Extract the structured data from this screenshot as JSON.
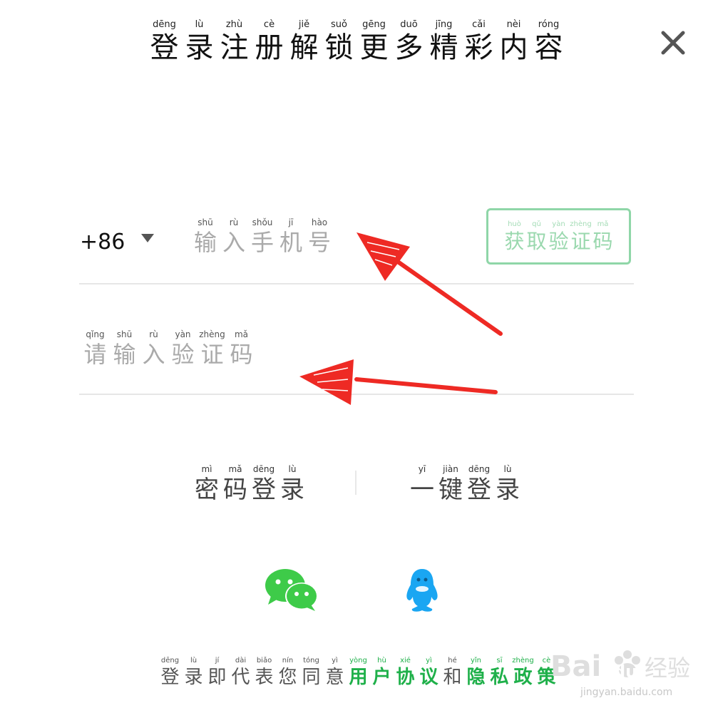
{
  "header": {
    "title": [
      {
        "hz": "登",
        "py": "dēng"
      },
      {
        "hz": "录",
        "py": "lù"
      },
      {
        "hz": "注",
        "py": "zhù"
      },
      {
        "hz": "册",
        "py": "cè"
      },
      {
        "hz": "解",
        "py": "jiě"
      },
      {
        "hz": "锁",
        "py": "suǒ"
      },
      {
        "hz": "更",
        "py": "gēng"
      },
      {
        "hz": "多",
        "py": "duō"
      },
      {
        "hz": "精",
        "py": "jīng"
      },
      {
        "hz": "彩",
        "py": "cǎi"
      },
      {
        "hz": "内",
        "py": "nèi"
      },
      {
        "hz": "容",
        "py": "róng"
      }
    ],
    "close_icon": "close-icon"
  },
  "phone": {
    "country_code": "+86",
    "placeholder": [
      {
        "hz": "输",
        "py": "shū"
      },
      {
        "hz": "入",
        "py": "rù"
      },
      {
        "hz": "手",
        "py": "shǒu"
      },
      {
        "hz": "机",
        "py": "jī"
      },
      {
        "hz": "号",
        "py": "hào"
      }
    ],
    "get_code_button": [
      {
        "hz": "获",
        "py": "huò"
      },
      {
        "hz": "取",
        "py": "qǔ"
      },
      {
        "hz": "验",
        "py": "yàn"
      },
      {
        "hz": "证",
        "py": "zhèng"
      },
      {
        "hz": "码",
        "py": "mǎ"
      }
    ]
  },
  "code": {
    "placeholder": [
      {
        "hz": "请",
        "py": "qǐng"
      },
      {
        "hz": "输",
        "py": "shū"
      },
      {
        "hz": "入",
        "py": "rù"
      },
      {
        "hz": "验",
        "py": "yàn"
      },
      {
        "hz": "证",
        "py": "zhèng"
      },
      {
        "hz": "码",
        "py": "mǎ"
      }
    ]
  },
  "login_options": {
    "password": [
      {
        "hz": "密",
        "py": "mì"
      },
      {
        "hz": "码",
        "py": "mǎ"
      },
      {
        "hz": "登",
        "py": "dēng"
      },
      {
        "hz": "录",
        "py": "lù"
      }
    ],
    "one_click": [
      {
        "hz": "一",
        "py": "yī"
      },
      {
        "hz": "键",
        "py": "jiàn"
      },
      {
        "hz": "登",
        "py": "dēng"
      },
      {
        "hz": "录",
        "py": "lù"
      }
    ]
  },
  "social": {
    "wechat_icon": "wechat-icon",
    "qq_icon": "qq-icon"
  },
  "agreement": {
    "prefix": [
      {
        "hz": "登",
        "py": "dēng"
      },
      {
        "hz": "录",
        "py": "lù"
      },
      {
        "hz": "即",
        "py": "jí"
      },
      {
        "hz": "代",
        "py": "dài"
      },
      {
        "hz": "表",
        "py": "biǎo"
      },
      {
        "hz": "您",
        "py": "nín"
      },
      {
        "hz": "同",
        "py": "tóng"
      },
      {
        "hz": "意",
        "py": "yì"
      }
    ],
    "user_agreement": [
      {
        "hz": "用",
        "py": "yòng"
      },
      {
        "hz": "户",
        "py": "hù"
      },
      {
        "hz": "协",
        "py": "xié"
      },
      {
        "hz": "议",
        "py": "yì"
      }
    ],
    "and": [
      {
        "hz": "和",
        "py": "hé"
      }
    ],
    "privacy_policy": [
      {
        "hz": "隐",
        "py": "yǐn"
      },
      {
        "hz": "私",
        "py": "sī"
      },
      {
        "hz": "政",
        "py": "zhèng"
      },
      {
        "hz": "策",
        "py": "cè"
      }
    ]
  },
  "watermark": {
    "brand": "Bai",
    "brand_tail": "du",
    "product": "经验",
    "url": "jingyan.baidu.com"
  },
  "colors": {
    "accent_green": "#1fb04a",
    "button_border": "#8fd6a8",
    "wechat": "#3ecb49",
    "qq": "#1aa6f2",
    "arrow": "#ee2a24"
  }
}
